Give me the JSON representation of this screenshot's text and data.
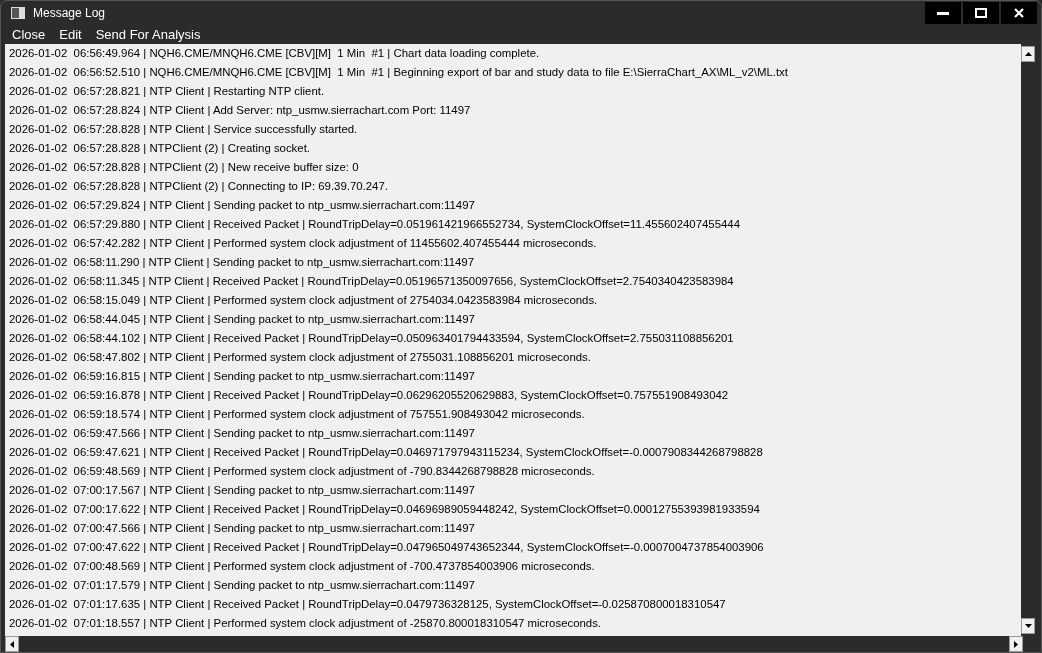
{
  "window": {
    "title": "Message Log"
  },
  "menu": [
    "Close",
    "Edit",
    "Send For Analysis"
  ],
  "log_lines": [
    "2026-01-02  06:56:49.964 | NQH6.CME/MNQH6.CME [CBV][M]  1 Min  #1 | Chart data loading complete.",
    "2026-01-02  06:56:52.510 | NQH6.CME/MNQH6.CME [CBV][M]  1 Min  #1 | Beginning export of bar and study data to file E:\\SierraChart_AX\\ML_v2\\ML.txt",
    "2026-01-02  06:57:28.821 | NTP Client | Restarting NTP client.",
    "2026-01-02  06:57:28.824 | NTP Client | Add Server: ntp_usmw.sierrachart.com Port: 11497",
    "2026-01-02  06:57:28.828 | NTP Client | Service successfully started.",
    "2026-01-02  06:57:28.828 | NTPClient (2) | Creating socket.",
    "2026-01-02  06:57:28.828 | NTPClient (2) | New receive buffer size: 0",
    "2026-01-02  06:57:28.828 | NTPClient (2) | Connecting to IP: 69.39.70.247.",
    "2026-01-02  06:57:29.824 | NTP Client | Sending packet to ntp_usmw.sierrachart.com:11497",
    "2026-01-02  06:57:29.880 | NTP Client | Received Packet | RoundTripDelay=0.051961421966552734, SystemClockOffset=11.455602407455444",
    "2026-01-02  06:57:42.282 | NTP Client | Performed system clock adjustment of 11455602.407455444 microseconds.",
    "2026-01-02  06:58:11.290 | NTP Client | Sending packet to ntp_usmw.sierrachart.com:11497",
    "2026-01-02  06:58:11.345 | NTP Client | Received Packet | RoundTripDelay=0.05196571350097656, SystemClockOffset=2.7540340423583984",
    "2026-01-02  06:58:15.049 | NTP Client | Performed system clock adjustment of 2754034.0423583984 microseconds.",
    "2026-01-02  06:58:44.045 | NTP Client | Sending packet to ntp_usmw.sierrachart.com:11497",
    "2026-01-02  06:58:44.102 | NTP Client | Received Packet | RoundTripDelay=0.050963401794433594, SystemClockOffset=2.755031108856201",
    "2026-01-02  06:58:47.802 | NTP Client | Performed system clock adjustment of 2755031.108856201 microseconds.",
    "2026-01-02  06:59:16.815 | NTP Client | Sending packet to ntp_usmw.sierrachart.com:11497",
    "2026-01-02  06:59:16.878 | NTP Client | Received Packet | RoundTripDelay=0.06296205520629883, SystemClockOffset=0.757551908493042",
    "2026-01-02  06:59:18.574 | NTP Client | Performed system clock adjustment of 757551.908493042 microseconds.",
    "2026-01-02  06:59:47.566 | NTP Client | Sending packet to ntp_usmw.sierrachart.com:11497",
    "2026-01-02  06:59:47.621 | NTP Client | Received Packet | RoundTripDelay=0.046971797943115234, SystemClockOffset=-0.0007908344268798828",
    "2026-01-02  06:59:48.569 | NTP Client | Performed system clock adjustment of -790.8344268798828 microseconds.",
    "2026-01-02  07:00:17.567 | NTP Client | Sending packet to ntp_usmw.sierrachart.com:11497",
    "2026-01-02  07:00:17.622 | NTP Client | Received Packet | RoundTripDelay=0.04696989059448242, SystemClockOffset=0.00012755393981933594",
    "2026-01-02  07:00:47.566 | NTP Client | Sending packet to ntp_usmw.sierrachart.com:11497",
    "2026-01-02  07:00:47.622 | NTP Client | Received Packet | RoundTripDelay=0.047965049743652344, SystemClockOffset=-0.0007004737854003906",
    "2026-01-02  07:00:48.569 | NTP Client | Performed system clock adjustment of -700.4737854003906 microseconds.",
    "2026-01-02  07:01:17.579 | NTP Client | Sending packet to ntp_usmw.sierrachart.com:11497",
    "2026-01-02  07:01:17.635 | NTP Client | Received Packet | RoundTripDelay=0.0479736328125, SystemClockOffset=-0.025870800018310547",
    "2026-01-02  07:01:18.557 | NTP Client | Performed system clock adjustment of -25870.800018310547 microseconds."
  ]
}
